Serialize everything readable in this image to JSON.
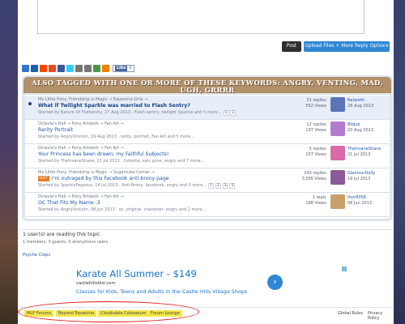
{
  "buttons": {
    "post": "Post",
    "upload": "Upload Files + More Reply Options"
  },
  "share": {
    "icons": [
      "delicious-icon",
      "digg-icon",
      "reddit-icon",
      "stumbleupon-icon",
      "facebook-icon",
      "twitter-icon",
      "email-icon",
      "print-icon",
      "download-icon",
      "blogger-icon"
    ],
    "like": "Like",
    "like_count": "0"
  },
  "banner": "ALSO TAGGED WITH ONE OR MORE OF THESE KEYWORDS: ANGRY, VENTING, MAD, UGH, GRRRR",
  "topics": [
    {
      "breadcrumb": "My Little Pony: Friendship is Magic → Equestria Girls →",
      "title": "What if Twilight Sparkle was married to Flash Sentry?",
      "meta": "Started by Nature Of Fluttershy, 27 Aug 2013 · Flash sentry, twilight Sparkle and 5 more...",
      "pages": [
        "1",
        "2"
      ],
      "replies": "31 replies",
      "views": "552 Views",
      "last_user": "Balareth",
      "last_date": "28 Aug 2013",
      "avatar_color": "#5b74b8"
    },
    {
      "breadcrumb": "Octavia's Hall → Pony Artwork → Fan Art →",
      "title": "Rarity Portrait",
      "meta": "Started by AngryUnicorn, 19 Aug 2013 · rarity, portrait, Fan Art and 5 more...",
      "pages": [],
      "replies": "12 replies",
      "views": "197 Views",
      "last_user": "Blique",
      "last_date": "20 Aug 2013",
      "avatar_color": "#b47ad0"
    },
    {
      "breadcrumb": "Octavia's Hall → Pony Artwork → Fan Art →",
      "title": "Your Princess has been drawn; my Faithful Subjects!",
      "meta": "Started by TheInsaneShane, 21 Jul 2013 · Celestia, epic pose, angry and 7 more...",
      "pages": [],
      "replies": "5 replies",
      "views": "157 Views",
      "last_user": "TheInsaneShane",
      "last_date": "21 Jul 2013",
      "avatar_color": "#d86aa8"
    },
    {
      "breadcrumb": "My Little Pony: Friendship is Magic → Sugarcube Corner →",
      "title": "I'm outraged by this Facebook anti-brony page",
      "meta": "Started by SparklyPegasus, 14 Jul 2013 · Anti-Brony, facebook, angry and 3 more...",
      "pages": [
        "1",
        "2",
        "3",
        "5"
      ],
      "hot": "HOT",
      "replies": "143 replies",
      "views": "3,095 Views",
      "last_user": "GlamourDolly",
      "last_date": "19 Jul 2013",
      "avatar_color": "#8a5a9a"
    },
    {
      "breadcrumb": "Octavia's Hall → Pony Artwork → Fan Art →",
      "title": "OC That Fits My Name :3",
      "meta": "Started by AngryUnicorn, 08 Jun 2013 · oc, original, character, angry and 2 more...",
      "pages": [],
      "replies": "1 reply",
      "views": "188 Views",
      "last_user": "thor9356",
      "last_date": "08 Jun 2013",
      "avatar_color": "#c8a06a"
    }
  ],
  "readers": {
    "title": "1 user(s) are reading this topic",
    "sub": "1 members, 0 guests, 0 anonymous users"
  },
  "psyche": "Psyche Clops",
  "ad": {
    "title": "Karate All Summer - $149",
    "url": "castlehillstkd.com",
    "desc": "Classes for Kids, Teens and Adults in the Castle Hills Village Shops",
    "arrow": "›"
  },
  "footer": {
    "breadcrumbs": [
      "MLP Forums",
      "Beyond Equestria",
      "Cloudsdale Colosseum",
      "Forum Lounge"
    ],
    "global_rules": "Global Rules",
    "privacy": "Privacy Policy"
  }
}
